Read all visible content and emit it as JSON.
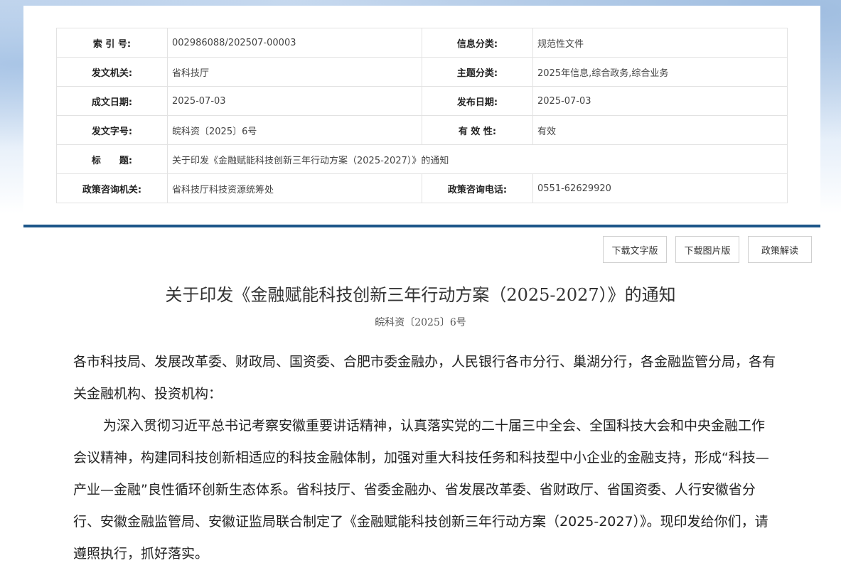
{
  "meta": {
    "index_label": "索 引 号:",
    "index_value": "002986088/202507-00003",
    "category_label": "信息分类:",
    "category_value": "规范性文件",
    "issuer_label": "发文机关:",
    "issuer_value": "省科技厅",
    "topic_label": "主题分类:",
    "topic_value": "2025年信息,综合政务,综合业务",
    "created_label": "成文日期:",
    "created_value": "2025-07-03",
    "published_label": "发布日期:",
    "published_value": "2025-07-03",
    "docno_label": "发文字号:",
    "docno_value": "皖科资〔2025〕6号",
    "validity_label": "有 效 性:",
    "validity_value": "有效",
    "title_label": "标　　题:",
    "title_value": "关于印发《金融赋能科技创新三年行动方案（2025-2027）》的通知",
    "consult_org_label": "政策咨询机关:",
    "consult_org_value": "省科技厅科技资源统筹处",
    "consult_phone_label": "政策咨询电话:",
    "consult_phone_value": "0551-62629920"
  },
  "buttons": {
    "download_text": "下载文字版",
    "download_image": "下载图片版",
    "interpretation": "政策解读"
  },
  "document": {
    "title": "关于印发《金融赋能科技创新三年行动方案（2025-2027）》的通知",
    "number": "皖科资〔2025〕6号",
    "recipients": " 各市科技局、发展改革委、财政局、国资委、合肥市委金融办，人民银行各市分行、巢湖分行，各金融监管分局，各有关金融机构、投资机构：",
    "paragraph1": "为深入贯彻习近平总书记考察安徽重要讲话精神，认真落实党的二十届三中全会、全国科技大会和中央金融工作会议精神，构建同科技创新相适应的科技金融体制，加强对重大科技任务和科技型中小企业的金融支持，形成“科技—产业—金融”良性循环创新生态体系。省科技厅、省委金融办、省发展改革委、省财政厅、省国资委、人行安徽省分行、安徽金融监管局、安徽证监局联合制定了《金融赋能科技创新三年行动方案（2025-2027）》。现印发给你们，请遵照执行，抓好落实。"
  }
}
